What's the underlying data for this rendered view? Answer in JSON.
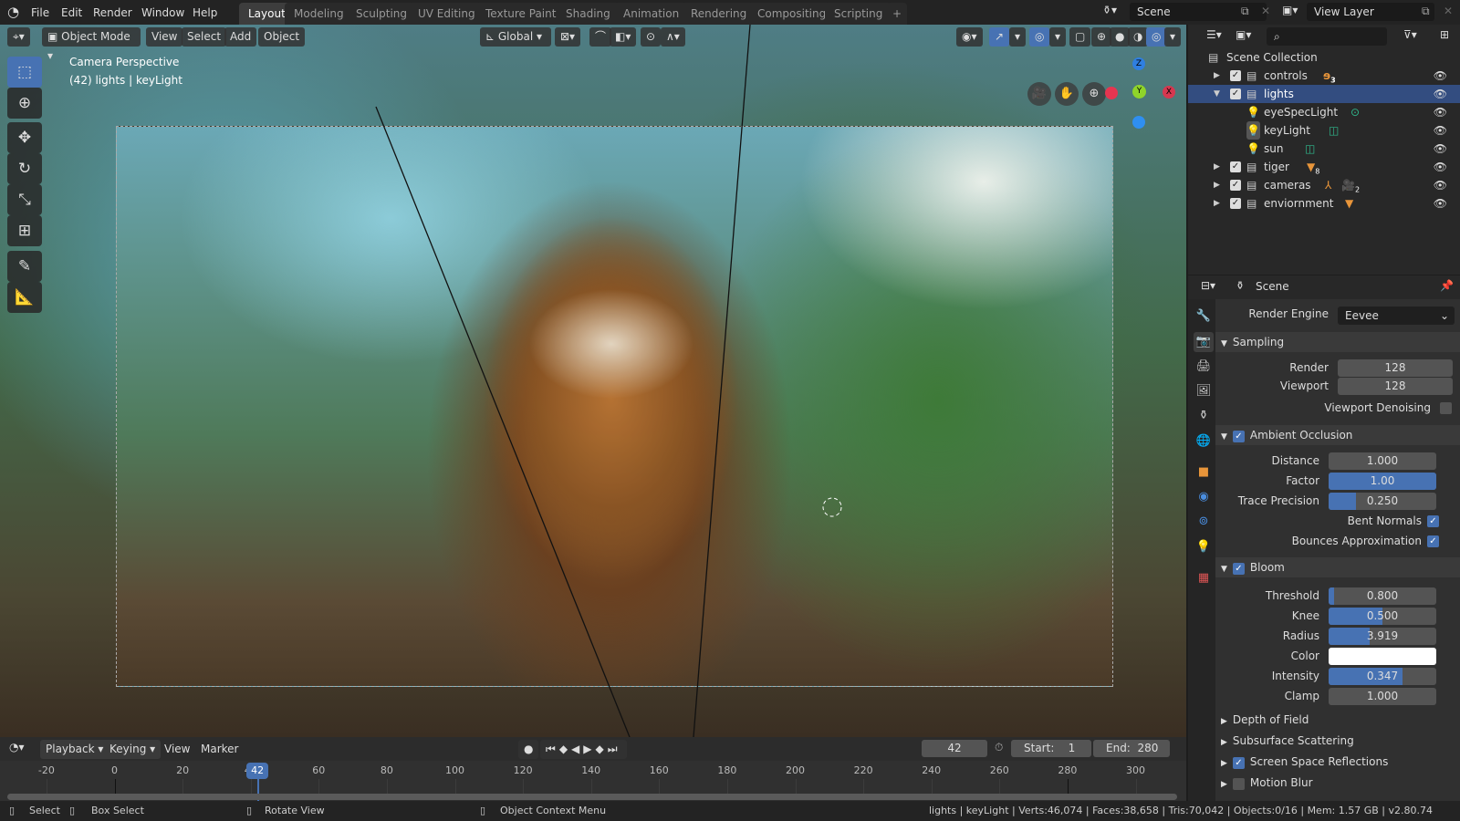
{
  "menu": [
    "File",
    "Edit",
    "Render",
    "Window",
    "Help"
  ],
  "workspaces": [
    "Layout",
    "Modeling",
    "Sculpting",
    "UV Editing",
    "Texture Paint",
    "Shading",
    "Animation",
    "Rendering",
    "Compositing",
    "Scripting"
  ],
  "active_workspace": "Layout",
  "add_workspace": "+",
  "scene": "Scene",
  "view_layer": "View Layer",
  "viewport": {
    "mode": "Object Mode",
    "header_menus": [
      "View",
      "Select",
      "Add",
      "Object"
    ],
    "orientation": "Global",
    "overlay_title": "Camera Perspective",
    "overlay_sub": "(42) lights | keyLight",
    "axes": [
      "Z",
      "Y",
      "X"
    ],
    "tools": [
      "select-box-icon",
      "cursor-icon",
      "move-icon",
      "rotate-icon",
      "scale-icon",
      "transform-icon",
      "annotate-icon",
      "measure-icon"
    ]
  },
  "outliner": {
    "root": "Scene Collection",
    "items": [
      {
        "name": "controls",
        "badge": "3",
        "level": 0
      },
      {
        "name": "lights",
        "level": 0,
        "selected": true
      },
      {
        "name": "eyeSpecLight",
        "level": 1
      },
      {
        "name": "keyLight",
        "level": 1
      },
      {
        "name": "sun",
        "level": 1
      },
      {
        "name": "tiger",
        "badge": "8",
        "level": 0
      },
      {
        "name": "cameras",
        "badge": "2",
        "level": 0
      },
      {
        "name": "enviornment",
        "level": 0
      }
    ]
  },
  "properties": {
    "context": "Scene",
    "render_engine_label": "Render Engine",
    "render_engine": "Eevee",
    "sampling": {
      "title": "Sampling",
      "render_label": "Render",
      "render": "128",
      "viewport_label": "Viewport",
      "viewport": "128",
      "denoise_label": "Viewport Denoising",
      "denoise": false
    },
    "ao": {
      "title": "Ambient Occlusion",
      "enabled": true,
      "distance_label": "Distance",
      "distance": "1.000",
      "factor_label": "Factor",
      "factor": "1.00",
      "factor_fill": 1.0,
      "trace_label": "Trace Precision",
      "trace": "0.250",
      "trace_fill": 0.25,
      "bent_label": "Bent Normals",
      "bent": true,
      "bounces_label": "Bounces Approximation",
      "bounces": true
    },
    "bloom": {
      "title": "Bloom",
      "enabled": true,
      "threshold_label": "Threshold",
      "threshold": "0.800",
      "threshold_fill": 0.05,
      "knee_label": "Knee",
      "knee": "0.500",
      "knee_fill": 0.5,
      "radius_label": "Radius",
      "radius": "3.919",
      "radius_fill": 0.38,
      "color_label": "Color",
      "color": "#ffffff",
      "intensity_label": "Intensity",
      "intensity": "0.347",
      "intensity_fill": 0.69,
      "clamp_label": "Clamp",
      "clamp": "1.000"
    },
    "collapsed": [
      {
        "title": "Depth of Field"
      },
      {
        "title": "Subsurface Scattering"
      },
      {
        "title": "Screen Space Reflections",
        "checkbox": true
      },
      {
        "title": "Motion Blur",
        "checkbox": false
      }
    ]
  },
  "timeline": {
    "menus": [
      "Playback",
      "Keying",
      "View",
      "Marker"
    ],
    "current_frame": "42",
    "start_label": "Start:",
    "start": "1",
    "end_label": "End:",
    "end": "280",
    "ticks": [
      "-20",
      "0",
      "20",
      "40",
      "60",
      "80",
      "100",
      "120",
      "140",
      "160",
      "180",
      "200",
      "220",
      "240",
      "260",
      "280",
      "300"
    ]
  },
  "statusbar": {
    "select": "Select",
    "box_select": "Box Select",
    "rotate_view": "Rotate View",
    "context_menu": "Object Context Menu",
    "stats": "lights | keyLight | Verts:46,074 | Faces:38,658 | Tris:70,042 | Objects:0/16 | Mem: 1.57 GB | v2.80.74"
  },
  "colors": {
    "accent": "#4772b3",
    "selection": "#334d80",
    "object_orange": "#e8953a",
    "light_green": "#2fb88c"
  }
}
